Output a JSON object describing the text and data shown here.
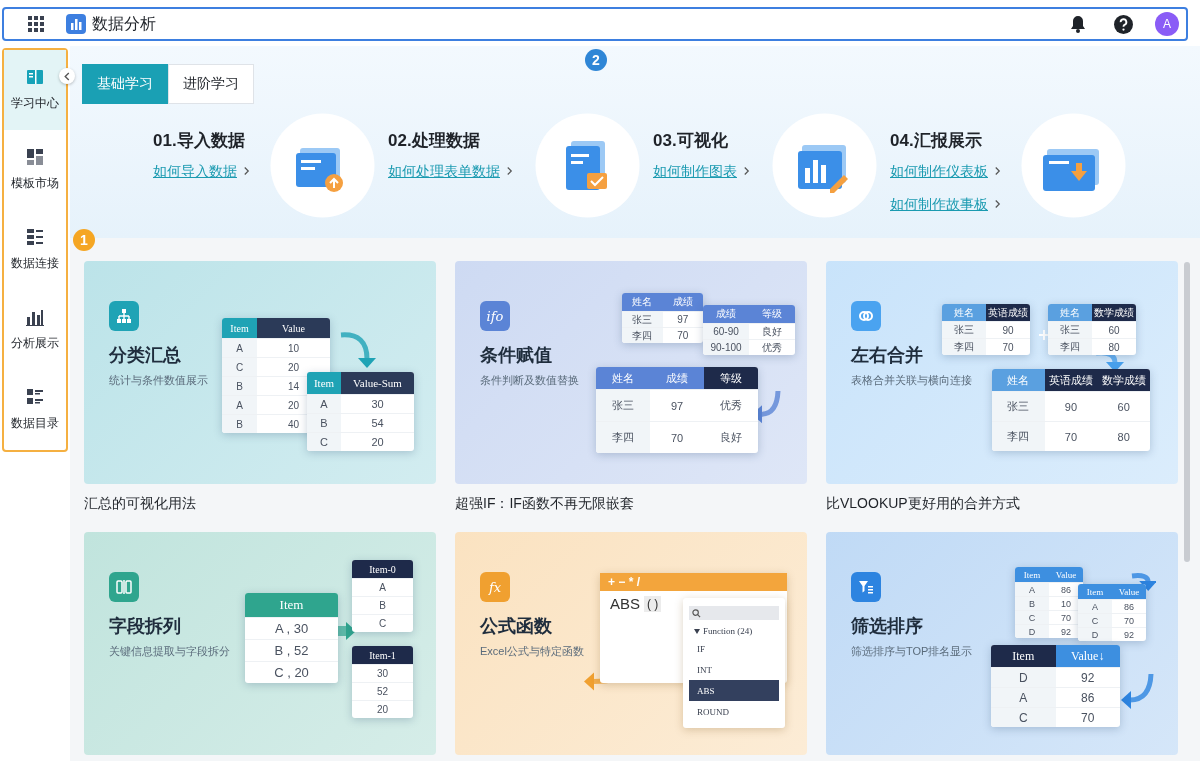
{
  "app_bar": {
    "title": "数据分析",
    "avatar": "A"
  },
  "sidebar": {
    "items": [
      {
        "label": "学习中心",
        "selected": true
      },
      {
        "label": "模板市场",
        "selected": false
      },
      {
        "label": "数据连接",
        "selected": false
      },
      {
        "label": "分析展示",
        "selected": false
      },
      {
        "label": "数据目录",
        "selected": false
      }
    ]
  },
  "annotations": [
    {
      "label": "1",
      "color": "#f5a623"
    },
    {
      "label": "2",
      "color": "#2f86d6"
    }
  ],
  "tabs": [
    {
      "label": "基础学习",
      "selected": true
    },
    {
      "label": "进阶学习",
      "selected": false
    }
  ],
  "steps": [
    {
      "title": "01.导入数据",
      "links": [
        "如何导入数据"
      ]
    },
    {
      "title": "02.处理数据",
      "links": [
        "如何处理表单数据"
      ]
    },
    {
      "title": "03.可视化",
      "links": [
        "如何制作图表"
      ]
    },
    {
      "title": "04.汇报展示",
      "links": [
        "如何制作仪表板",
        "如何制作故事板"
      ]
    }
  ],
  "cards": [
    {
      "title": "分类汇总",
      "subtitle": "统计与条件数值展示",
      "caption": "汇总的可视化用法",
      "color": "#1fa3b5",
      "kind": "tables",
      "tables": [
        {
          "columns": [
            {
              "label": "Item",
              "color": "#1fa3b5"
            },
            {
              "label": "Value",
              "color": "#2b3a58"
            }
          ],
          "rows": [
            [
              "A",
              "10"
            ],
            [
              "C",
              "20"
            ],
            [
              "B",
              "14"
            ],
            [
              "A",
              "20"
            ],
            [
              "B",
              "40"
            ]
          ]
        },
        {
          "columns": [
            {
              "label": "Item",
              "color": "#1fa3b5"
            },
            {
              "label": "Value-Sum",
              "color": "#2b3a58"
            }
          ],
          "rows": [
            [
              "A",
              "30"
            ],
            [
              "B",
              "54"
            ],
            [
              "C",
              "20"
            ]
          ]
        }
      ]
    },
    {
      "title": "条件赋值",
      "subtitle": "条件判断及数值替换",
      "caption": "超强IF：IF函数不再无限嵌套",
      "color": "#5b84d6",
      "icon_text": "ifo",
      "kind": "tables",
      "tables": [
        {
          "columns": [
            {
              "label": "姓名",
              "color": "#5b84d6"
            },
            {
              "label": "成绩",
              "color": "#5b84d6"
            }
          ],
          "rows": [
            [
              "张三",
              "97"
            ],
            [
              "李四",
              "70"
            ]
          ]
        },
        {
          "columns": [
            {
              "label": "成绩",
              "color": "#5b84d6"
            },
            {
              "label": "等级",
              "color": "#5b84d6"
            }
          ],
          "rows": [
            [
              "60-90",
              "良好"
            ],
            [
              "90-100",
              "优秀"
            ]
          ]
        },
        {
          "columns": [
            {
              "label": "姓名",
              "color": "#5b84d6"
            },
            {
              "label": "成绩",
              "color": "#5b84d6"
            },
            {
              "label": "等级",
              "color": "#1e2a4a"
            }
          ],
          "rows": [
            [
              "张三",
              "97",
              "优秀"
            ],
            [
              "李四",
              "70",
              "良好"
            ]
          ]
        }
      ]
    },
    {
      "title": "左右合并",
      "subtitle": "表格合并关联与横向连接",
      "caption": "比VLOOKUP更好用的合并方式",
      "color": "#4aa3f0",
      "kind": "tables",
      "tables": [
        {
          "columns": [
            {
              "label": "姓名",
              "color": "#5aa0e0"
            },
            {
              "label": "英语成绩",
              "color": "#1e2a4a"
            }
          ],
          "rows": [
            [
              "张三",
              "90"
            ],
            [
              "李四",
              "70"
            ]
          ]
        },
        {
          "columns": [
            {
              "label": "姓名",
              "color": "#5aa0e0"
            },
            {
              "label": "数学成绩",
              "color": "#1e2a4a"
            }
          ],
          "rows": [
            [
              "张三",
              "60"
            ],
            [
              "李四",
              "80"
            ]
          ]
        },
        {
          "columns": [
            {
              "label": "姓名",
              "color": "#5aa0e0"
            },
            {
              "label": "英语成绩",
              "color": "#1e2a4a"
            },
            {
              "label": "数学成绩",
              "color": "#1e2a4a"
            }
          ],
          "rows": [
            [
              "张三",
              "90",
              "60"
            ],
            [
              "李四",
              "70",
              "80"
            ]
          ]
        }
      ]
    },
    {
      "title": "字段拆列",
      "subtitle": "关键信息提取与字段拆分",
      "color": "#2fa58e",
      "kind": "tables",
      "tables": [
        {
          "columns": [
            {
              "label": "Item",
              "color": "#2fa58e"
            }
          ],
          "rows": [
            [
              "A , 30"
            ],
            [
              "B , 52"
            ],
            [
              "C , 20"
            ]
          ]
        },
        {
          "columns": [
            {
              "label": "Item-0",
              "color": "#1e2a4a"
            }
          ],
          "rows": [
            [
              "A"
            ],
            [
              "B"
            ],
            [
              "C"
            ]
          ]
        },
        {
          "columns": [
            {
              "label": "Item-1",
              "color": "#1e2a4a"
            }
          ],
          "rows": [
            [
              "30"
            ],
            [
              "52"
            ],
            [
              "20"
            ]
          ]
        }
      ]
    },
    {
      "title": "公式函数",
      "subtitle": "Excel公式与特定函数",
      "color": "#f0a030",
      "icon_text": "fx",
      "kind": "formula",
      "formula": {
        "operators": "+ − * /",
        "expression": "ABS",
        "args": "( )",
        "group": "Function (24)",
        "functions": [
          {
            "name": "IF",
            "selected": false
          },
          {
            "name": "INT",
            "selected": false
          },
          {
            "name": "ABS",
            "selected": true
          },
          {
            "name": "ROUND",
            "selected": false
          }
        ]
      }
    },
    {
      "title": "筛选排序",
      "subtitle": "筛选排序与TOP排名显示",
      "color": "#2d84e0",
      "kind": "tables",
      "tables": [
        {
          "columns": [
            {
              "label": "Item",
              "color": "#3d8fe0"
            },
            {
              "label": "Value",
              "color": "#3d8fe0"
            }
          ],
          "rows": [
            [
              "A",
              "86"
            ],
            [
              "B",
              "10"
            ],
            [
              "C",
              "70"
            ],
            [
              "D",
              "92"
            ]
          ]
        },
        {
          "columns": [
            {
              "label": "Item",
              "color": "#3d8fe0"
            },
            {
              "label": "Value",
              "color": "#3d8fe0"
            }
          ],
          "rows": [
            [
              "A",
              "86"
            ],
            [
              "C",
              "70"
            ],
            [
              "D",
              "92"
            ]
          ]
        },
        {
          "columns": [
            {
              "label": "Item",
              "color": "#1e2a4a"
            },
            {
              "label": "Value↓",
              "color": "#3d8fe0"
            }
          ],
          "rows": [
            [
              "D",
              "92"
            ],
            [
              "A",
              "86"
            ],
            [
              "C",
              "70"
            ]
          ]
        }
      ]
    }
  ]
}
